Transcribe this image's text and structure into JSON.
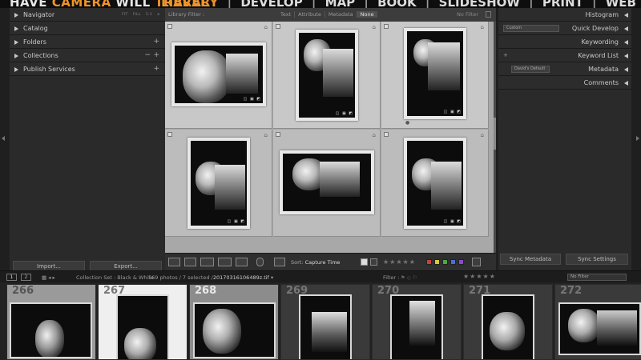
{
  "identity": {
    "part1": "HAVE ",
    "accent": "CAMERA",
    "part2": " WILL ",
    "accent2": "TRAVEL"
  },
  "modules": [
    {
      "label": "LIBRARY",
      "active": true
    },
    {
      "label": "DEVELOP",
      "active": false
    },
    {
      "label": "MAP",
      "active": false
    },
    {
      "label": "BOOK",
      "active": false
    },
    {
      "label": "SLIDESHOW",
      "active": false
    },
    {
      "label": "PRINT",
      "active": false
    },
    {
      "label": "WEB",
      "active": false
    }
  ],
  "module_sep": "|",
  "left_panel": {
    "navigator": {
      "label": "Navigator",
      "zoom": [
        "FIT",
        "FILL",
        "1:1",
        "≑"
      ]
    },
    "catalog": "Catalog",
    "folders": "Folders",
    "collections": "Collections",
    "publish": "Publish Services",
    "plus": "+",
    "minus": "−",
    "import_btn": "Import...",
    "export_btn": "Export..."
  },
  "filter_bar": {
    "label": "Library Filter :",
    "options": [
      "Text",
      "Attribute",
      "Metadata",
      "None"
    ],
    "selected": "None",
    "no_filter": "No Filter"
  },
  "grid_cells": [
    {
      "selected": true
    },
    {
      "selected": true
    },
    {
      "selected": true
    },
    {
      "selected": false
    },
    {
      "selected": false
    },
    {
      "selected": false
    }
  ],
  "photo_badges": "◫ ▣ ◩",
  "rating_dot": "●",
  "toolbar": {
    "sort_label": "Sort:",
    "sort_value": "Capture Time",
    "stars": "★★★★★",
    "swatches": [
      "#c8423a",
      "#d8c83a",
      "#4ea844",
      "#4a6ed8",
      "#8a4ad0"
    ]
  },
  "right_panel": {
    "histogram": "Histogram",
    "quick_develop": "Quick Develop",
    "quick_develop_preset": "Custom",
    "keywording": "Keywording",
    "keyword_list": "Keyword List",
    "keyword_plus": "+",
    "metadata": "Metadata",
    "metadata_preset": "David's Default",
    "comments": "Comments",
    "sync_metadata": "Sync Metadata",
    "sync_settings": "Sync Settings"
  },
  "filmstrip_bar": {
    "page1": "1",
    "page2": "2",
    "source": "Collection Set : Black & White",
    "count": "569 photos / 7 selected /",
    "filename": "20170316106489z.tif",
    "filter_label": "Filter :",
    "stars": "★★★★★",
    "no_filter": "No Filter"
  },
  "filmstrip": [
    {
      "num": "266",
      "selected": true
    },
    {
      "num": "267",
      "selected": false
    },
    {
      "num": "268",
      "selected": false
    },
    {
      "num": "269",
      "selected": false
    },
    {
      "num": "270",
      "selected": false
    },
    {
      "num": "271",
      "selected": false
    },
    {
      "num": "272",
      "selected": false
    }
  ]
}
